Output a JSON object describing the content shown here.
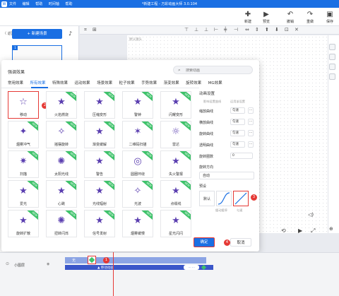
{
  "titlebar": {
    "logo": "W",
    "menu": [
      "文件",
      "编辑",
      "帮助",
      "时间轴",
      "帮助"
    ],
    "app_title": "*新建工程 - 万彩动画大师 3.0.104"
  },
  "toolbar": {
    "buttons": [
      {
        "label": "新建",
        "icon": "new-icon"
      },
      {
        "label": "预览",
        "icon": "preview-icon"
      },
      {
        "label": "撤销",
        "icon": "undo-icon"
      },
      {
        "label": "重做",
        "icon": "redo-icon"
      },
      {
        "label": "保存",
        "icon": "save-icon"
      }
    ]
  },
  "left_panel": {
    "back_home": "〈 返回主页",
    "new_scene": "+ 新建场景",
    "scene_number": "1"
  },
  "stage": {
    "label": "默认镜头"
  },
  "modal": {
    "title": "强调效果",
    "search_placeholder": "搜索动画",
    "tabs": [
      "常用效果",
      "所有效果",
      "特殊效果",
      "运动效果",
      "场景效果",
      "粒子效果",
      "手势效果",
      "渐变效果",
      "旋转效果",
      "MG效果"
    ],
    "active_tab": "所有效果",
    "effects": [
      {
        "label": "移动",
        "new": false,
        "selected": true,
        "glyph": "☆",
        "badge": "2"
      },
      {
        "label": "火焰燃烧",
        "new": true,
        "glyph": "★"
      },
      {
        "label": "压缩变形",
        "new": true,
        "glyph": "★"
      },
      {
        "label": "警钟",
        "new": true,
        "glyph": "★"
      },
      {
        "label": "闪耀变形",
        "new": true,
        "glyph": "★"
      },
      {
        "label": "烟雾冲气",
        "new": true,
        "glyph": "✦"
      },
      {
        "label": "摇摆旋转",
        "new": true,
        "glyph": "✧"
      },
      {
        "label": "渐变缓解",
        "new": true,
        "glyph": "★"
      },
      {
        "label": "二维码扫描",
        "new": true,
        "glyph": "✶"
      },
      {
        "label": "雷达",
        "new": true,
        "glyph": "☼"
      },
      {
        "label": "扫描",
        "new": true,
        "glyph": "✷"
      },
      {
        "label": "太阳光线",
        "new": true,
        "glyph": "✺"
      },
      {
        "label": "警告",
        "new": true,
        "glyph": "★"
      },
      {
        "label": "圆圈环绕",
        "new": true,
        "glyph": "◎"
      },
      {
        "label": "失火警报",
        "new": true,
        "glyph": "★"
      },
      {
        "label": "爱光",
        "new": true,
        "glyph": "★"
      },
      {
        "label": "心跳",
        "new": true,
        "glyph": "★"
      },
      {
        "label": "光线辐射",
        "new": true,
        "glyph": "★"
      },
      {
        "label": "光波",
        "new": true,
        "glyph": "✧"
      },
      {
        "label": "点缀线",
        "new": true,
        "glyph": "★"
      },
      {
        "label": "旋转扩散",
        "new": true,
        "glyph": "★"
      },
      {
        "label": "扭转闪烁",
        "new": true,
        "glyph": "✺"
      },
      {
        "label": "信号发射",
        "new": true,
        "glyph": "★"
      },
      {
        "label": "烟雾缓慢",
        "new": true,
        "glyph": "★"
      },
      {
        "label": "星光闪闪",
        "new": true,
        "glyph": "★"
      }
    ],
    "settings": {
      "title": "动画设置",
      "col_head_1": "影响设置曲线",
      "col_head_2": "运用该设置",
      "rows": [
        {
          "label": "缩放曲线",
          "value": "匀速"
        },
        {
          "label": "横放曲线",
          "value": "匀速"
        },
        {
          "label": "旋转曲线",
          "value": "匀速"
        },
        {
          "label": "透明曲线",
          "value": "匀速"
        },
        {
          "label": "旋转圈数",
          "value": "0"
        }
      ],
      "direction_label": "旋转方向",
      "direction_value": "自动",
      "preset_label": "预设",
      "curve_default": "默认",
      "curve_caption_1": "缓动缓停",
      "curve_caption_2": "匀速",
      "badge": "3"
    },
    "ok_label": "确定",
    "ok_badge": "4",
    "cancel_label": "取消"
  },
  "timeline": {
    "row_label": "小图层",
    "track_label": "无",
    "track2_label": "▲ 移动动画",
    "marker_badge": "1"
  },
  "colors": {
    "accent": "#1a6fe3",
    "highlight": "#e53935",
    "new_tag": "#3ec26a",
    "icon": "#5b3fb0"
  }
}
